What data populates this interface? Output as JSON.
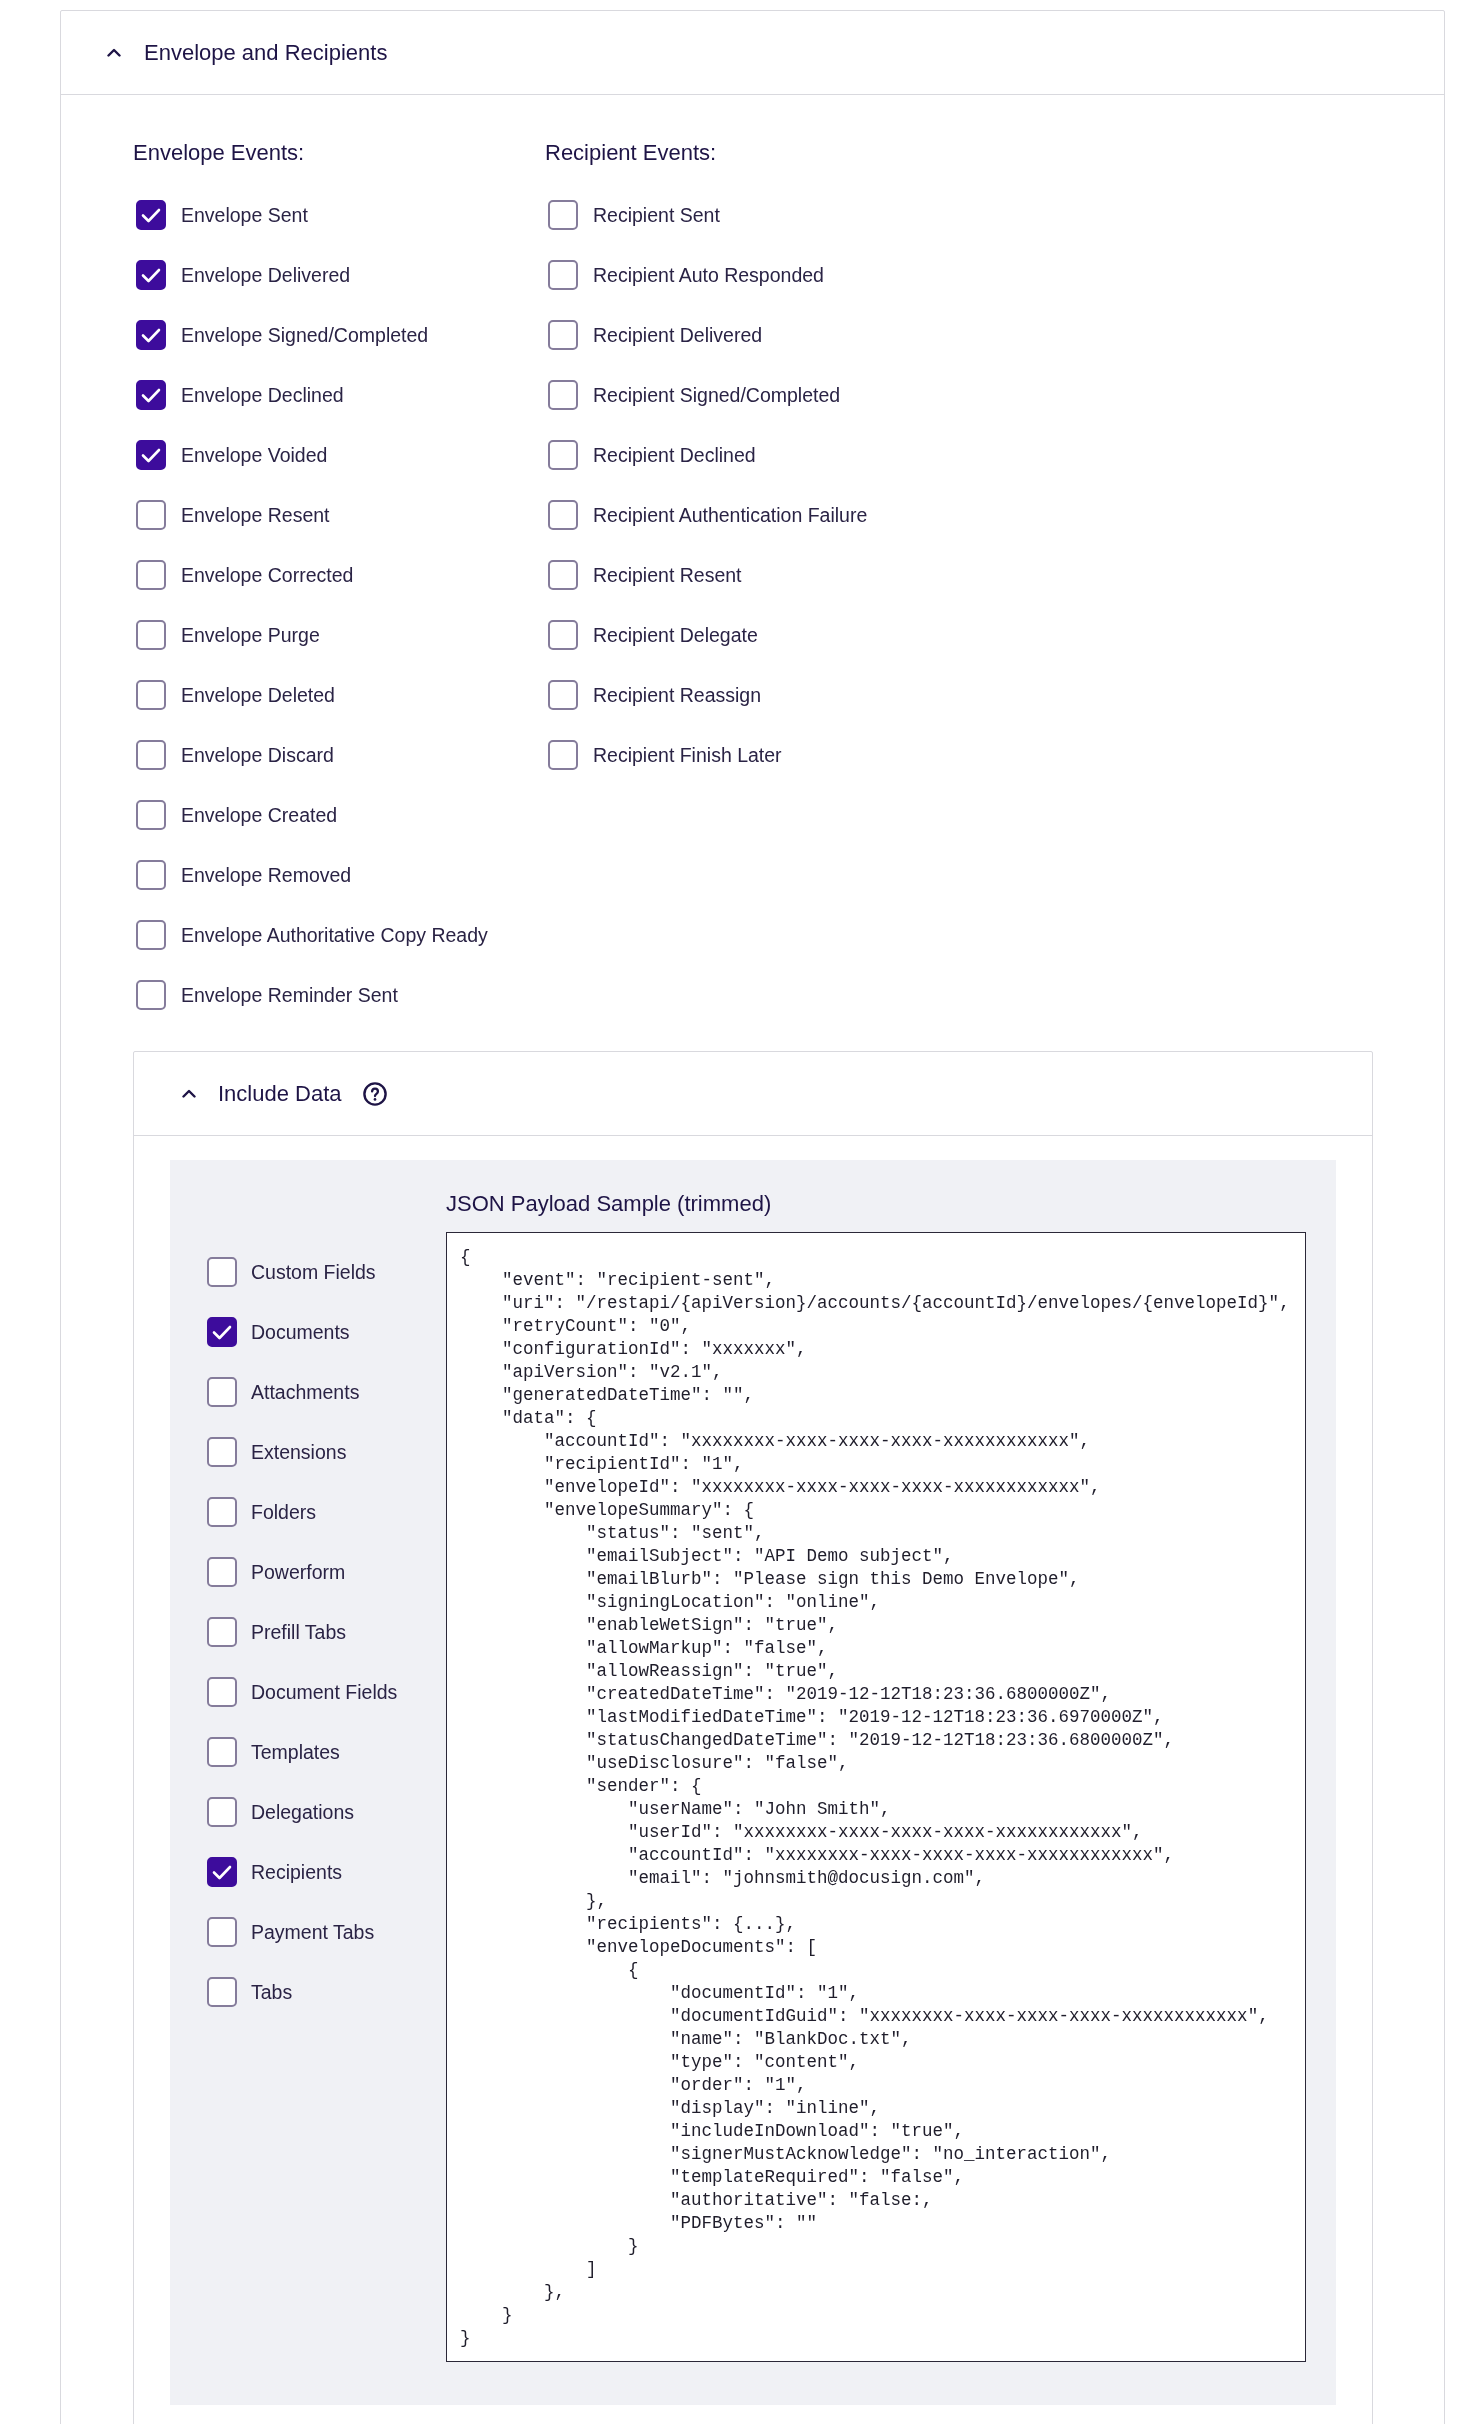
{
  "envelope_and_recipients": {
    "title": "Envelope and Recipients",
    "expanded": true,
    "envelope_events": {
      "heading": "Envelope Events:",
      "items": [
        {
          "label": "Envelope Sent",
          "checked": true
        },
        {
          "label": "Envelope Delivered",
          "checked": true
        },
        {
          "label": "Envelope Signed/Completed",
          "checked": true
        },
        {
          "label": "Envelope Declined",
          "checked": true
        },
        {
          "label": "Envelope Voided",
          "checked": true
        },
        {
          "label": "Envelope Resent",
          "checked": false
        },
        {
          "label": "Envelope Corrected",
          "checked": false
        },
        {
          "label": "Envelope Purge",
          "checked": false
        },
        {
          "label": "Envelope Deleted",
          "checked": false
        },
        {
          "label": "Envelope Discard",
          "checked": false
        },
        {
          "label": "Envelope Created",
          "checked": false
        },
        {
          "label": "Envelope Removed",
          "checked": false
        },
        {
          "label": "Envelope Authoritative Copy Ready",
          "checked": false
        },
        {
          "label": "Envelope Reminder Sent",
          "checked": false
        }
      ]
    },
    "recipient_events": {
      "heading": "Recipient Events:",
      "items": [
        {
          "label": "Recipient Sent",
          "checked": false
        },
        {
          "label": "Recipient Auto Responded",
          "checked": false
        },
        {
          "label": "Recipient Delivered",
          "checked": false
        },
        {
          "label": "Recipient Signed/Completed",
          "checked": false
        },
        {
          "label": "Recipient Declined",
          "checked": false
        },
        {
          "label": "Recipient Authentication Failure",
          "checked": false
        },
        {
          "label": "Recipient Resent",
          "checked": false
        },
        {
          "label": "Recipient Delegate",
          "checked": false
        },
        {
          "label": "Recipient Reassign",
          "checked": false
        },
        {
          "label": "Recipient Finish Later",
          "checked": false
        }
      ]
    },
    "include_data": {
      "title": "Include Data",
      "expanded": true,
      "options": [
        {
          "label": "Custom Fields",
          "checked": false
        },
        {
          "label": "Documents",
          "checked": true
        },
        {
          "label": "Attachments",
          "checked": false
        },
        {
          "label": "Extensions",
          "checked": false
        },
        {
          "label": "Folders",
          "checked": false
        },
        {
          "label": "Powerform",
          "checked": false
        },
        {
          "label": "Prefill Tabs",
          "checked": false
        },
        {
          "label": "Document Fields",
          "checked": false
        },
        {
          "label": "Templates",
          "checked": false
        },
        {
          "label": "Delegations",
          "checked": false
        },
        {
          "label": "Recipients",
          "checked": true
        },
        {
          "label": "Payment Tabs",
          "checked": false
        },
        {
          "label": "Tabs",
          "checked": false
        }
      ],
      "payload_sample": {
        "title": "JSON Payload Sample (trimmed)",
        "lines": [
          "{",
          "    \"event\": \"recipient-sent\",",
          "    \"uri\": \"/restapi/{apiVersion}/accounts/{accountId}/envelopes/{envelopeId}\",",
          "    \"retryCount\": \"0\",",
          "    \"configurationId\": \"xxxxxxx\",",
          "    \"apiVersion\": \"v2.1\",",
          "    \"generatedDateTime\": \"\",",
          "    \"data\": {",
          "        \"accountId\": \"xxxxxxxx-xxxx-xxxx-xxxx-xxxxxxxxxxxx\",",
          "        \"recipientId\": \"1\",",
          "        \"envelopeId\": \"xxxxxxxx-xxxx-xxxx-xxxx-xxxxxxxxxxxx\",",
          "        \"envelopeSummary\": {",
          "            \"status\": \"sent\",",
          "            \"emailSubject\": \"API Demo subject\",",
          "            \"emailBlurb\": \"Please sign this Demo Envelope\",",
          "            \"signingLocation\": \"online\",",
          "            \"enableWetSign\": \"true\",",
          "            \"allowMarkup\": \"false\",",
          "            \"allowReassign\": \"true\",",
          "            \"createdDateTime\": \"2019-12-12T18:23:36.6800000Z\",",
          "            \"lastModifiedDateTime\": \"2019-12-12T18:23:36.6970000Z\",",
          "            \"statusChangedDateTime\": \"2019-12-12T18:23:36.6800000Z\",",
          "            \"useDisclosure\": \"false\",",
          "            \"sender\": {",
          "                \"userName\": \"John Smith\",",
          "                \"userId\": \"xxxxxxxx-xxxx-xxxx-xxxx-xxxxxxxxxxxx\",",
          "                \"accountId\": \"xxxxxxxx-xxxx-xxxx-xxxx-xxxxxxxxxxxx\",",
          "                \"email\": \"johnsmith@docusign.com\",",
          "            },",
          "            \"recipients\": {...},",
          "            \"envelopeDocuments\": [",
          "                {",
          "                    \"documentId\": \"1\",",
          "                    \"documentIdGuid\": \"xxxxxxxx-xxxx-xxxx-xxxx-xxxxxxxxxxxx\",",
          "                    \"name\": \"BlankDoc.txt\",",
          "                    \"type\": \"content\",",
          "                    \"order\": \"1\",",
          "                    \"display\": \"inline\",",
          "                    \"includeInDownload\": \"true\",",
          "                    \"signerMustAcknowledge\": \"no_interaction\",",
          "                    \"templateRequired\": \"false\",",
          "                    \"authoritative\": \"false:,",
          "                    \"PDFBytes\": \"\"",
          "                }",
          "            ]",
          "        },",
          "    }",
          "}"
        ]
      }
    }
  }
}
